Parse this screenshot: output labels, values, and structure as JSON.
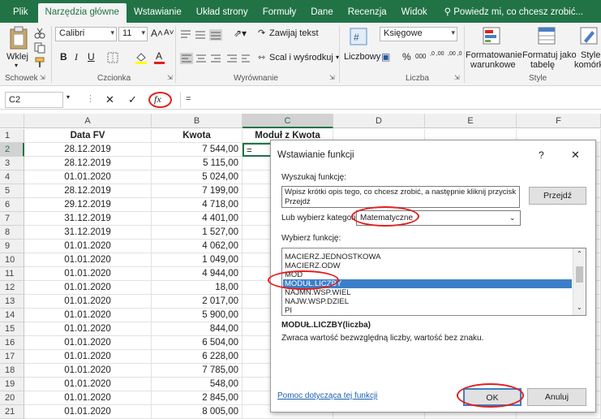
{
  "ribbon_tabs": [
    "Plik",
    "Narzędzia główne",
    "Wstawianie",
    "Układ strony",
    "Formuły",
    "Dane",
    "Recenzja",
    "Widok"
  ],
  "tell_me": "Powiedz mi, co chcesz zrobić...",
  "ribbon": {
    "paste_label": "Wklej",
    "font_name": "Calibri",
    "font_size": "11",
    "bold": "B",
    "italic": "I",
    "underline": "U",
    "grow_font": "A˄",
    "shrink_font": "A˅",
    "wrap_text": "Zawijaj tekst",
    "merge_center": "Scal i wyśrodkuj",
    "number_format_label": "Liczbowy",
    "number_format_value": "Księgowe",
    "percent": "%",
    "thousands": "000",
    "dec_inc": ",0 ,00",
    "dec_dec": ",00 ,0",
    "conditional_formatting": [
      "Formatowanie",
      "warunkowe"
    ],
    "format_as_table": [
      "Formatuj jako",
      "tabelę"
    ],
    "cell_styles": [
      "Style",
      "komórki"
    ],
    "groups": [
      "Schowek",
      "Czcionka",
      "Wyrównanie",
      "Liczba",
      "Style"
    ]
  },
  "formula_bar": {
    "name_box": "C2",
    "cancel": "✕",
    "enter": "✓",
    "fx": "fx",
    "formula": "="
  },
  "columns": [
    "A",
    "B",
    "C",
    "D",
    "E",
    "F"
  ],
  "headers_row": [
    "Data FV",
    "Kwota",
    "Moduł z Kwota"
  ],
  "rows": [
    {
      "n": "1"
    },
    {
      "n": "2",
      "a": "28.12.2019",
      "dash": "",
      "b": "7 544,00",
      "c": "="
    },
    {
      "n": "3",
      "a": "28.12.2019",
      "dash": "",
      "b": "5 115,00"
    },
    {
      "n": "4",
      "a": "01.01.2020",
      "dash": "",
      "b": "5 024,00"
    },
    {
      "n": "5",
      "a": "28.12.2019",
      "dash": "",
      "b": "7 199,00"
    },
    {
      "n": "6",
      "a": "29.12.2019",
      "dash": "",
      "b": "4 718,00"
    },
    {
      "n": "7",
      "a": "31.12.2019",
      "dash": "",
      "b": "4 401,00"
    },
    {
      "n": "8",
      "a": "31.12.2019",
      "dash": "",
      "b": "1 527,00"
    },
    {
      "n": "9",
      "a": "01.01.2020",
      "dash": "",
      "b": "4 062,00"
    },
    {
      "n": "10",
      "a": "01.01.2020",
      "dash": "",
      "b": "1 049,00"
    },
    {
      "n": "11",
      "a": "01.01.2020",
      "dash": "-",
      "b": "4 944,00"
    },
    {
      "n": "12",
      "a": "01.01.2020",
      "dash": "",
      "b": "18,00"
    },
    {
      "n": "13",
      "a": "01.01.2020",
      "dash": "-",
      "b": "2 017,00"
    },
    {
      "n": "14",
      "a": "01.01.2020",
      "dash": "-",
      "b": "5 900,00"
    },
    {
      "n": "15",
      "a": "01.01.2020",
      "dash": "-",
      "b": "844,00"
    },
    {
      "n": "16",
      "a": "01.01.2020",
      "dash": "-",
      "b": "6 504,00"
    },
    {
      "n": "17",
      "a": "01.01.2020",
      "dash": "-",
      "b": "6 228,00"
    },
    {
      "n": "18",
      "a": "01.01.2020",
      "dash": "",
      "b": "7 785,00"
    },
    {
      "n": "19",
      "a": "01.01.2020",
      "dash": "",
      "b": "548,00"
    },
    {
      "n": "20",
      "a": "01.01.2020",
      "dash": "",
      "b": "2 845,00"
    },
    {
      "n": "21",
      "a": "01.01.2020",
      "dash": "",
      "b": "8 005,00"
    }
  ],
  "dialog": {
    "title": "Wstawianie funkcji",
    "help_glyph": "?",
    "close_glyph": "✕",
    "search_label": "Wyszukaj funkcję:",
    "search_text": "Wpisz krótki opis tego, co chcesz zrobić, a następnie kliknij przycisk Przejdź",
    "go_button": "Przejdź",
    "category_label": "Lub wybierz kategorię:",
    "category_value": "Matematyczne",
    "select_label": "Wybierz funkcję:",
    "functions": [
      "MACIERZ.JEDNOSTKOWA",
      "MACIERZ.ODW",
      "MOD",
      "MODUŁ.LICZBY",
      "NAJMN.WSP.WIEL",
      "NAJW.WSP.DZIEL",
      "PI"
    ],
    "selected_function": "MODUŁ.LICZBY",
    "signature": "MODUŁ.LICZBY(liczba)",
    "description": "Zwraca wartość bezwzględną liczby, wartość bez znaku.",
    "help_link": "Pomoc dotycząca tej funkcji",
    "ok_button": "OK",
    "cancel_button": "Anuluj"
  },
  "colors": {
    "excel_green": "#217346",
    "annotation_red": "#e0201e",
    "selection_blue": "#3c7fc9",
    "link_blue": "#1a5fb4"
  }
}
